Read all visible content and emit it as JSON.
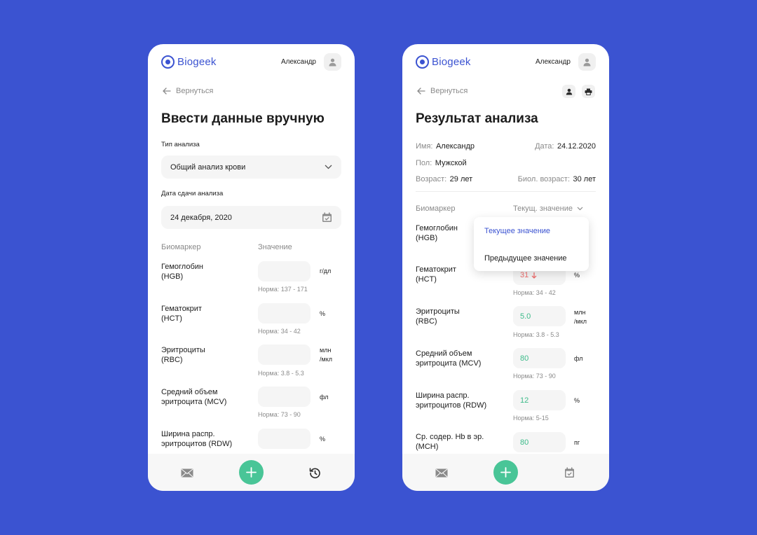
{
  "brand": {
    "name": "Biogeek",
    "accent": "#3b53d1",
    "green": "#49c597",
    "alert": "#ef6e6e"
  },
  "left": {
    "user": "Александр",
    "back_label": "Вернуться",
    "title": "Ввести данные вручную",
    "analysis_type_label": "Тип анализа",
    "analysis_type_value": "Общий анализ крови",
    "date_label": "Дата сдачи анализа",
    "date_value": "24 декабря, 2020",
    "col_biomarker": "Биомаркер",
    "col_value": "Значение",
    "rows": [
      {
        "name1": "Гемоглобин",
        "name2": "(HGB)",
        "unit1": "г/дл",
        "unit2": "",
        "norm": "Норма: 137 - 171"
      },
      {
        "name1": "Гематокрит",
        "name2": "(HCT)",
        "unit1": "%",
        "unit2": "",
        "norm": "Норма: 34 - 42"
      },
      {
        "name1": "Эритроциты",
        "name2": "(RBC)",
        "unit1": "млн",
        "unit2": "/мкл",
        "norm": "Норма: 3.8 - 5.3"
      },
      {
        "name1": "Средний объем",
        "name2": "эритроцита (MCV)",
        "unit1": "фл",
        "unit2": "",
        "norm": "Норма: 73 - 90"
      },
      {
        "name1": "Ширина распр.",
        "name2": "эритроцитов (RDW)",
        "unit1": "%",
        "unit2": "",
        "norm": ""
      }
    ],
    "bottom_icons": [
      "mail-icon",
      "plus-icon",
      "history-icon"
    ]
  },
  "right": {
    "user": "Александр",
    "back_label": "Вернуться",
    "title": "Результат анализа",
    "info": {
      "name_label": "Имя:",
      "name_value": "Александр",
      "date_label": "Дата:",
      "date_value": "24.12.2020",
      "sex_label": "Пол:",
      "sex_value": "Мужской",
      "age_label": "Возраст:",
      "age_value": "29 лет",
      "bioage_label": "Биол. возраст:",
      "bioage_value": "30 лет"
    },
    "col_biomarker": "Биомаркер",
    "col_value_select": "Текущ. значение",
    "dropdown": {
      "current": "Текущее значение",
      "previous": "Предыдущее значение"
    },
    "rows": [
      {
        "name1": "Гемоглобин",
        "name2": "(HGB)",
        "value": "",
        "unit1": "",
        "unit2": "",
        "norm": ""
      },
      {
        "name1": "Гематокрит",
        "name2": "(HCT)",
        "value": "31",
        "unit1": "%",
        "unit2": "",
        "norm": "Норма: 34 - 42"
      },
      {
        "name1": "Эритроциты",
        "name2": "(RBC)",
        "value": "5.0",
        "unit1": "млн",
        "unit2": "/мкл",
        "norm": "Норма: 3.8 - 5.3"
      },
      {
        "name1": "Средний объем",
        "name2": "эритроцита (MCV)",
        "value": "80",
        "unit1": "фл",
        "unit2": "",
        "norm": "Норма: 73 - 90"
      },
      {
        "name1": "Ширина распр.",
        "name2": "эритроцитов (RDW)",
        "value": "12",
        "unit1": "%",
        "unit2": "",
        "norm": "Норма: 5-15"
      },
      {
        "name1": "Ср. содер. Hb в эр.",
        "name2": "(MCH)",
        "value": "80",
        "unit1": "пг",
        "unit2": "",
        "norm": ""
      }
    ],
    "bottom_icons": [
      "mail-icon",
      "plus-icon",
      "calendar-check-icon"
    ]
  }
}
